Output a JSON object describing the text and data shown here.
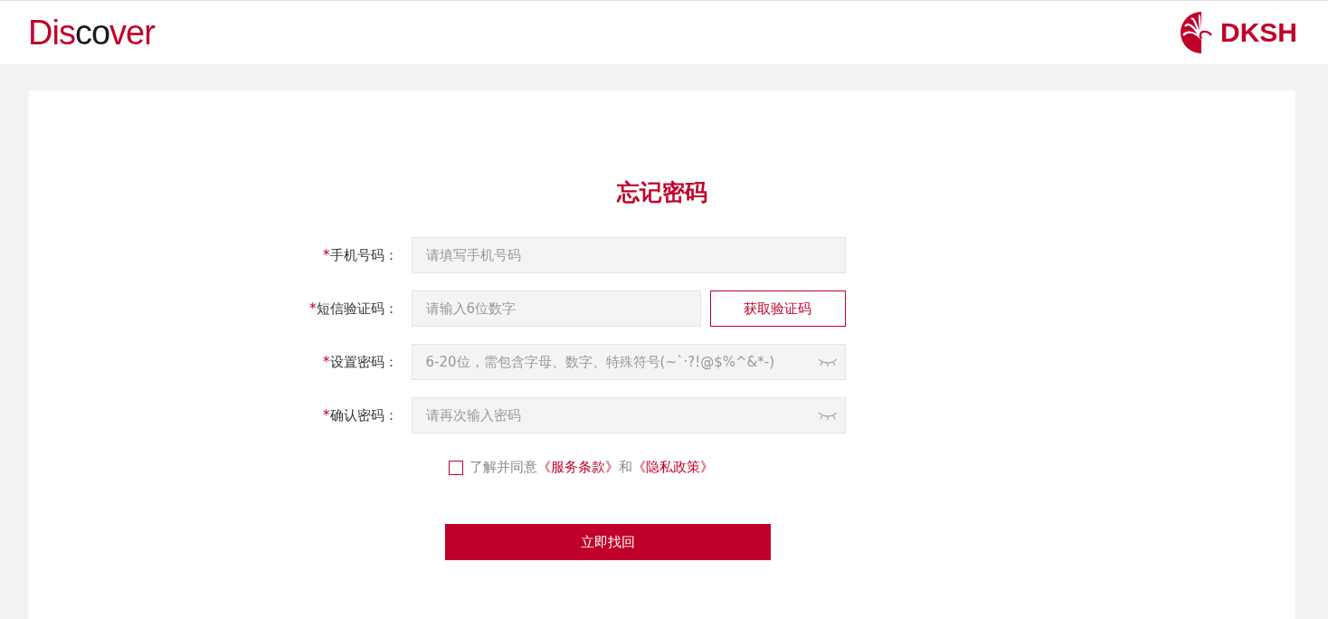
{
  "header": {
    "logo_parts": [
      {
        "text": "Dis",
        "color": "#c0002a"
      },
      {
        "text": "co",
        "color": "#1a1a1a"
      },
      {
        "text": "ver",
        "color": "#c0002a"
      }
    ],
    "brand": "DKSH"
  },
  "title": "忘记密码",
  "fields": [
    {
      "kind": "text",
      "label": "手机号码：",
      "marker": "*",
      "placeholder": "请填写手机号码"
    },
    {
      "kind": "code",
      "label": "短信验证码：",
      "marker": "*",
      "placeholder": "请输入6位数字",
      "button": "获取验证码"
    },
    {
      "kind": "password",
      "label": "设置密码：",
      "marker": "*",
      "placeholder": "6-20位，需包含字母、数字、特殊符号(~`·?!@$%^&*-)"
    },
    {
      "kind": "password",
      "label": "确认密码：",
      "marker": "*",
      "placeholder": "请再次输入密码"
    }
  ],
  "agreement": {
    "checked": false,
    "parts": [
      {
        "kind": "plain",
        "text": "了解并同意"
      },
      {
        "kind": "link",
        "text": "《服务条款》"
      },
      {
        "kind": "plain",
        "text": "和"
      },
      {
        "kind": "link",
        "text": "《隐私政策》"
      }
    ]
  },
  "submit": "立即找回"
}
